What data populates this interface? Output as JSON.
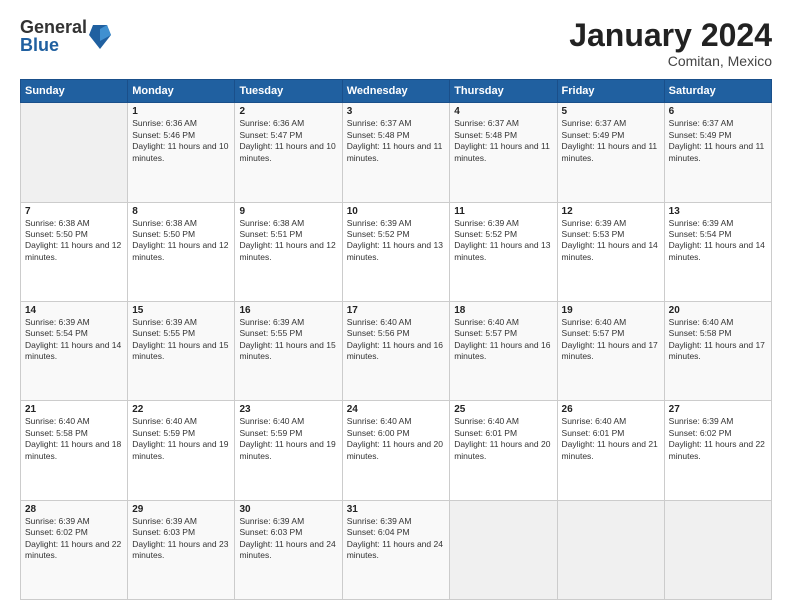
{
  "header": {
    "logo_general": "General",
    "logo_blue": "Blue",
    "month_title": "January 2024",
    "location": "Comitan, Mexico"
  },
  "days_of_week": [
    "Sunday",
    "Monday",
    "Tuesday",
    "Wednesday",
    "Thursday",
    "Friday",
    "Saturday"
  ],
  "weeks": [
    [
      {
        "day": "",
        "sunrise": "",
        "sunset": "",
        "daylight": ""
      },
      {
        "day": "1",
        "sunrise": "Sunrise: 6:36 AM",
        "sunset": "Sunset: 5:46 PM",
        "daylight": "Daylight: 11 hours and 10 minutes."
      },
      {
        "day": "2",
        "sunrise": "Sunrise: 6:36 AM",
        "sunset": "Sunset: 5:47 PM",
        "daylight": "Daylight: 11 hours and 10 minutes."
      },
      {
        "day": "3",
        "sunrise": "Sunrise: 6:37 AM",
        "sunset": "Sunset: 5:48 PM",
        "daylight": "Daylight: 11 hours and 11 minutes."
      },
      {
        "day": "4",
        "sunrise": "Sunrise: 6:37 AM",
        "sunset": "Sunset: 5:48 PM",
        "daylight": "Daylight: 11 hours and 11 minutes."
      },
      {
        "day": "5",
        "sunrise": "Sunrise: 6:37 AM",
        "sunset": "Sunset: 5:49 PM",
        "daylight": "Daylight: 11 hours and 11 minutes."
      },
      {
        "day": "6",
        "sunrise": "Sunrise: 6:37 AM",
        "sunset": "Sunset: 5:49 PM",
        "daylight": "Daylight: 11 hours and 11 minutes."
      }
    ],
    [
      {
        "day": "7",
        "sunrise": "Sunrise: 6:38 AM",
        "sunset": "Sunset: 5:50 PM",
        "daylight": "Daylight: 11 hours and 12 minutes."
      },
      {
        "day": "8",
        "sunrise": "Sunrise: 6:38 AM",
        "sunset": "Sunset: 5:50 PM",
        "daylight": "Daylight: 11 hours and 12 minutes."
      },
      {
        "day": "9",
        "sunrise": "Sunrise: 6:38 AM",
        "sunset": "Sunset: 5:51 PM",
        "daylight": "Daylight: 11 hours and 12 minutes."
      },
      {
        "day": "10",
        "sunrise": "Sunrise: 6:39 AM",
        "sunset": "Sunset: 5:52 PM",
        "daylight": "Daylight: 11 hours and 13 minutes."
      },
      {
        "day": "11",
        "sunrise": "Sunrise: 6:39 AM",
        "sunset": "Sunset: 5:52 PM",
        "daylight": "Daylight: 11 hours and 13 minutes."
      },
      {
        "day": "12",
        "sunrise": "Sunrise: 6:39 AM",
        "sunset": "Sunset: 5:53 PM",
        "daylight": "Daylight: 11 hours and 14 minutes."
      },
      {
        "day": "13",
        "sunrise": "Sunrise: 6:39 AM",
        "sunset": "Sunset: 5:54 PM",
        "daylight": "Daylight: 11 hours and 14 minutes."
      }
    ],
    [
      {
        "day": "14",
        "sunrise": "Sunrise: 6:39 AM",
        "sunset": "Sunset: 5:54 PM",
        "daylight": "Daylight: 11 hours and 14 minutes."
      },
      {
        "day": "15",
        "sunrise": "Sunrise: 6:39 AM",
        "sunset": "Sunset: 5:55 PM",
        "daylight": "Daylight: 11 hours and 15 minutes."
      },
      {
        "day": "16",
        "sunrise": "Sunrise: 6:39 AM",
        "sunset": "Sunset: 5:55 PM",
        "daylight": "Daylight: 11 hours and 15 minutes."
      },
      {
        "day": "17",
        "sunrise": "Sunrise: 6:40 AM",
        "sunset": "Sunset: 5:56 PM",
        "daylight": "Daylight: 11 hours and 16 minutes."
      },
      {
        "day": "18",
        "sunrise": "Sunrise: 6:40 AM",
        "sunset": "Sunset: 5:57 PM",
        "daylight": "Daylight: 11 hours and 16 minutes."
      },
      {
        "day": "19",
        "sunrise": "Sunrise: 6:40 AM",
        "sunset": "Sunset: 5:57 PM",
        "daylight": "Daylight: 11 hours and 17 minutes."
      },
      {
        "day": "20",
        "sunrise": "Sunrise: 6:40 AM",
        "sunset": "Sunset: 5:58 PM",
        "daylight": "Daylight: 11 hours and 17 minutes."
      }
    ],
    [
      {
        "day": "21",
        "sunrise": "Sunrise: 6:40 AM",
        "sunset": "Sunset: 5:58 PM",
        "daylight": "Daylight: 11 hours and 18 minutes."
      },
      {
        "day": "22",
        "sunrise": "Sunrise: 6:40 AM",
        "sunset": "Sunset: 5:59 PM",
        "daylight": "Daylight: 11 hours and 19 minutes."
      },
      {
        "day": "23",
        "sunrise": "Sunrise: 6:40 AM",
        "sunset": "Sunset: 5:59 PM",
        "daylight": "Daylight: 11 hours and 19 minutes."
      },
      {
        "day": "24",
        "sunrise": "Sunrise: 6:40 AM",
        "sunset": "Sunset: 6:00 PM",
        "daylight": "Daylight: 11 hours and 20 minutes."
      },
      {
        "day": "25",
        "sunrise": "Sunrise: 6:40 AM",
        "sunset": "Sunset: 6:01 PM",
        "daylight": "Daylight: 11 hours and 20 minutes."
      },
      {
        "day": "26",
        "sunrise": "Sunrise: 6:40 AM",
        "sunset": "Sunset: 6:01 PM",
        "daylight": "Daylight: 11 hours and 21 minutes."
      },
      {
        "day": "27",
        "sunrise": "Sunrise: 6:39 AM",
        "sunset": "Sunset: 6:02 PM",
        "daylight": "Daylight: 11 hours and 22 minutes."
      }
    ],
    [
      {
        "day": "28",
        "sunrise": "Sunrise: 6:39 AM",
        "sunset": "Sunset: 6:02 PM",
        "daylight": "Daylight: 11 hours and 22 minutes."
      },
      {
        "day": "29",
        "sunrise": "Sunrise: 6:39 AM",
        "sunset": "Sunset: 6:03 PM",
        "daylight": "Daylight: 11 hours and 23 minutes."
      },
      {
        "day": "30",
        "sunrise": "Sunrise: 6:39 AM",
        "sunset": "Sunset: 6:03 PM",
        "daylight": "Daylight: 11 hours and 24 minutes."
      },
      {
        "day": "31",
        "sunrise": "Sunrise: 6:39 AM",
        "sunset": "Sunset: 6:04 PM",
        "daylight": "Daylight: 11 hours and 24 minutes."
      },
      {
        "day": "",
        "sunrise": "",
        "sunset": "",
        "daylight": ""
      },
      {
        "day": "",
        "sunrise": "",
        "sunset": "",
        "daylight": ""
      },
      {
        "day": "",
        "sunrise": "",
        "sunset": "",
        "daylight": ""
      }
    ]
  ]
}
